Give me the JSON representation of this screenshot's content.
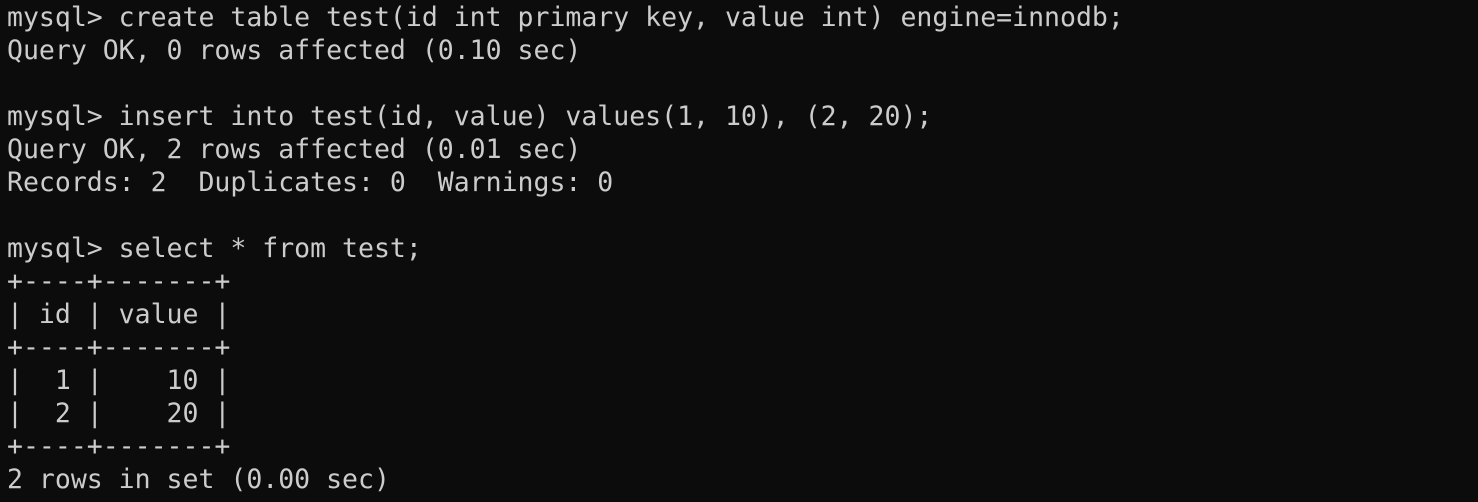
{
  "terminal": {
    "lines": [
      "mysql> create table test(id int primary key, value int) engine=innodb;",
      "Query OK, 0 rows affected (0.10 sec)",
      "",
      "mysql> insert into test(id, value) values(1, 10), (2, 20);",
      "Query OK, 2 rows affected (0.01 sec)",
      "Records: 2  Duplicates: 0  Warnings: 0",
      "",
      "mysql> select * from test;",
      "+----+-------+",
      "| id | value |",
      "+----+-------+",
      "|  1 |    10 |",
      "|  2 |    20 |",
      "+----+-------+",
      "2 rows in set (0.00 sec)"
    ],
    "colors": {
      "background": "#0c0c0c",
      "foreground": "#cccccc"
    }
  }
}
